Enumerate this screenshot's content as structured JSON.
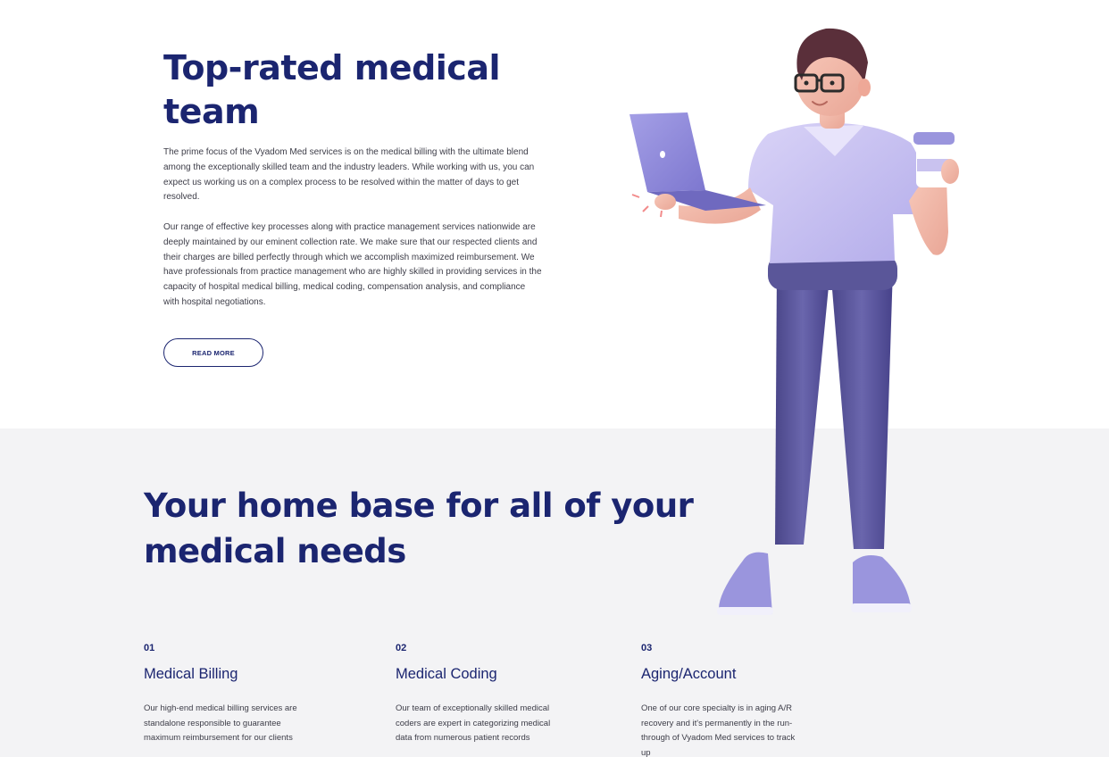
{
  "hero": {
    "title": "Top-rated medical team",
    "paragraph1": "The prime focus of the Vyadom Med services is on the medical billing with the ultimate blend among the exceptionally skilled team and the industry leaders. While working with us, you can expect us working us on a complex process to be resolved within the matter of days to get resolved.",
    "paragraph2": "Our range of effective key processes along with practice management services nationwide are deeply maintained by our eminent collection rate. We make sure that our respected clients and their charges are billed perfectly through which we accomplish maximized reimbursement. We have professionals from practice management who are highly skilled in providing services in the capacity of hospital medical billing, medical coding, compensation analysis, and compliance with hospital negotiations.",
    "read_more_label": "READ MORE"
  },
  "services_section": {
    "title": "Your home base for all of your medical needs",
    "items": [
      {
        "number": "01",
        "name": "Medical Billing",
        "description": "Our high-end medical billing services are standalone responsible to guarantee maximum reimbursement for our clients"
      },
      {
        "number": "02",
        "name": "Medical Coding",
        "description": "Our team of exceptionally skilled medical coders are expert in categorizing medical data from numerous patient records"
      },
      {
        "number": "03",
        "name": "Aging/Account",
        "description": "One of our core specialty is in aging A/R recovery and it's permanently in the run-through of Vyadom Med services to track up"
      }
    ]
  },
  "illustration": {
    "icon": "person-with-laptop-and-coffee-illustration",
    "colors": {
      "shirt": "#c9c2ef",
      "pants": "#5a5699",
      "shoes": "#9a95dd",
      "skin": "#f2b7a8",
      "hair": "#5a2f3a"
    }
  },
  "colors": {
    "heading": "#1b2570",
    "body_text": "#3d3d48",
    "section_bg": "#f3f3f5"
  }
}
